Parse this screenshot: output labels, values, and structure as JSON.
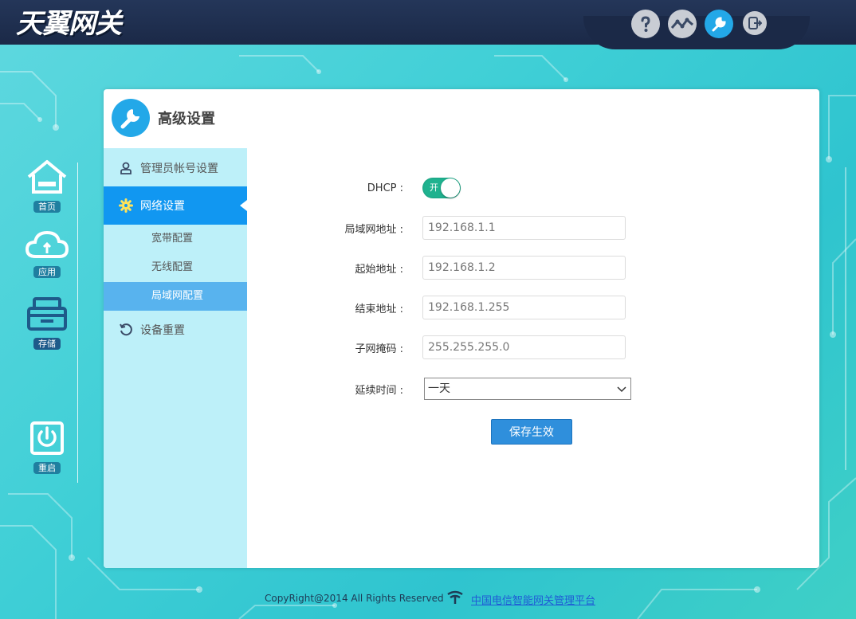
{
  "header": {
    "logo_text": "天翼网关",
    "icons": [
      "help-icon",
      "stats-icon",
      "settings-icon",
      "logout-icon"
    ],
    "active_icon": "settings-icon"
  },
  "dock": {
    "items": [
      {
        "label": "首页",
        "icon": "home-icon"
      },
      {
        "label": "应用",
        "icon": "cloud-icon"
      },
      {
        "label": "存储",
        "icon": "storage-icon"
      },
      {
        "label": "重启",
        "icon": "power-icon"
      }
    ]
  },
  "panel": {
    "title": "高级设置",
    "icon": "wrench-icon"
  },
  "sidebar": {
    "items": [
      {
        "label": "管理员帐号设置",
        "icon": "user-icon"
      },
      {
        "label": "网络设置",
        "icon": "gear-icon",
        "active": true
      },
      {
        "label": "设备重置",
        "icon": "reset-icon"
      }
    ],
    "subitems": [
      {
        "label": "宽带配置"
      },
      {
        "label": "无线配置"
      },
      {
        "label": "局域网配置",
        "active": true
      }
    ]
  },
  "form": {
    "dhcp_label": "DHCP :",
    "dhcp_toggle_text": "开",
    "dhcp_enabled": true,
    "lan_ip_label": "局域网地址 :",
    "lan_ip_value": "192.168.1.1",
    "start_label": "起始地址 :",
    "start_value": "192.168.1.2",
    "end_label": "结束地址 :",
    "end_value": "192.168.1.255",
    "mask_label": "子网掩码 :",
    "mask_value": "255.255.255.0",
    "lease_label": "延续时间 :",
    "lease_value": "一天",
    "save_label": "保存生效"
  },
  "footer": {
    "copyright": "CopyRight@2014 All Rights Reserved",
    "link_text": "中国电信智能网关管理平台"
  },
  "colors": {
    "accent": "#23a8e8",
    "sidebar_active": "#1197f1",
    "sidebar_bg": "#bdf0f9",
    "toggle_on": "#1fb28f",
    "header_bg": "#1b2947"
  }
}
